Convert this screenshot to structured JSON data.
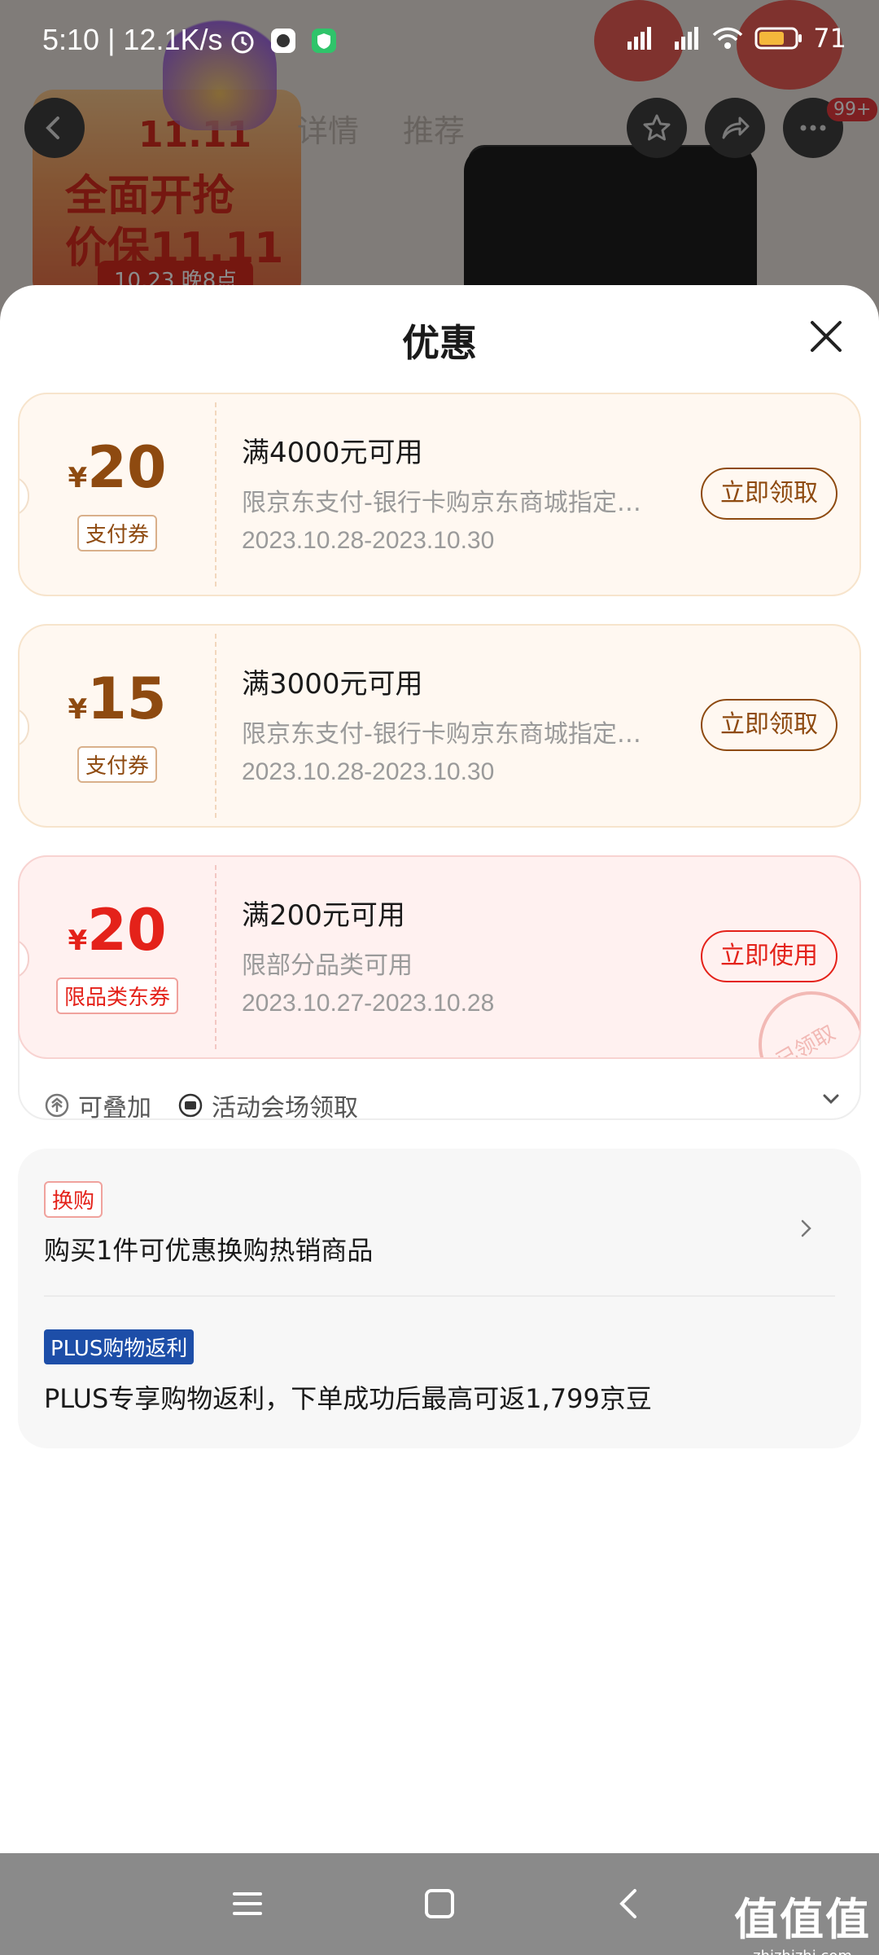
{
  "status_bar": {
    "time": "5:10 | 12.1K/s",
    "battery": "71"
  },
  "background": {
    "banner_line1": "11.11",
    "banner_line2": "全面开抢",
    "banner_line3": "价保11.11",
    "banner_line4": "10.23 晚8点",
    "tabs": [
      "详情",
      "推荐"
    ],
    "badge": "99+"
  },
  "sheet": {
    "title": "优惠",
    "coupons": [
      {
        "currency": "¥",
        "amount": "20",
        "type": "支付券",
        "title": "满4000元可用",
        "desc": "限京东支付-银行卡购京东商城指定商品",
        "dates": "2023.10.28-2023.10.30",
        "button": "立即领取"
      },
      {
        "currency": "¥",
        "amount": "15",
        "type": "支付券",
        "title": "满3000元可用",
        "desc": "限京东支付-银行卡购京东商城指定商品",
        "dates": "2023.10.28-2023.10.30",
        "button": "立即领取"
      },
      {
        "currency": "¥",
        "amount": "20",
        "type": "限品类东券",
        "title": "满200元可用",
        "desc": "限部分品类可用",
        "dates": "2023.10.27-2023.10.28",
        "button": "立即使用",
        "stamp": "已领取"
      }
    ],
    "stack_label": "可叠加",
    "venue_label": "活动会场领取",
    "promos": {
      "exchange_tag": "换购",
      "exchange_text": "购买1件可优惠换购热销商品",
      "plus_tag": "PLUS购物返利",
      "plus_text": "PLUS专享购物返利，下单成功后最高可返1,799京豆"
    }
  },
  "watermark": {
    "line1": "值值值",
    "line2": "zhizhizhi.com"
  },
  "colors": {
    "coupon_orange": "#8e4a10",
    "coupon_red": "#e4221a",
    "plus_blue": "#1d4ea8"
  }
}
